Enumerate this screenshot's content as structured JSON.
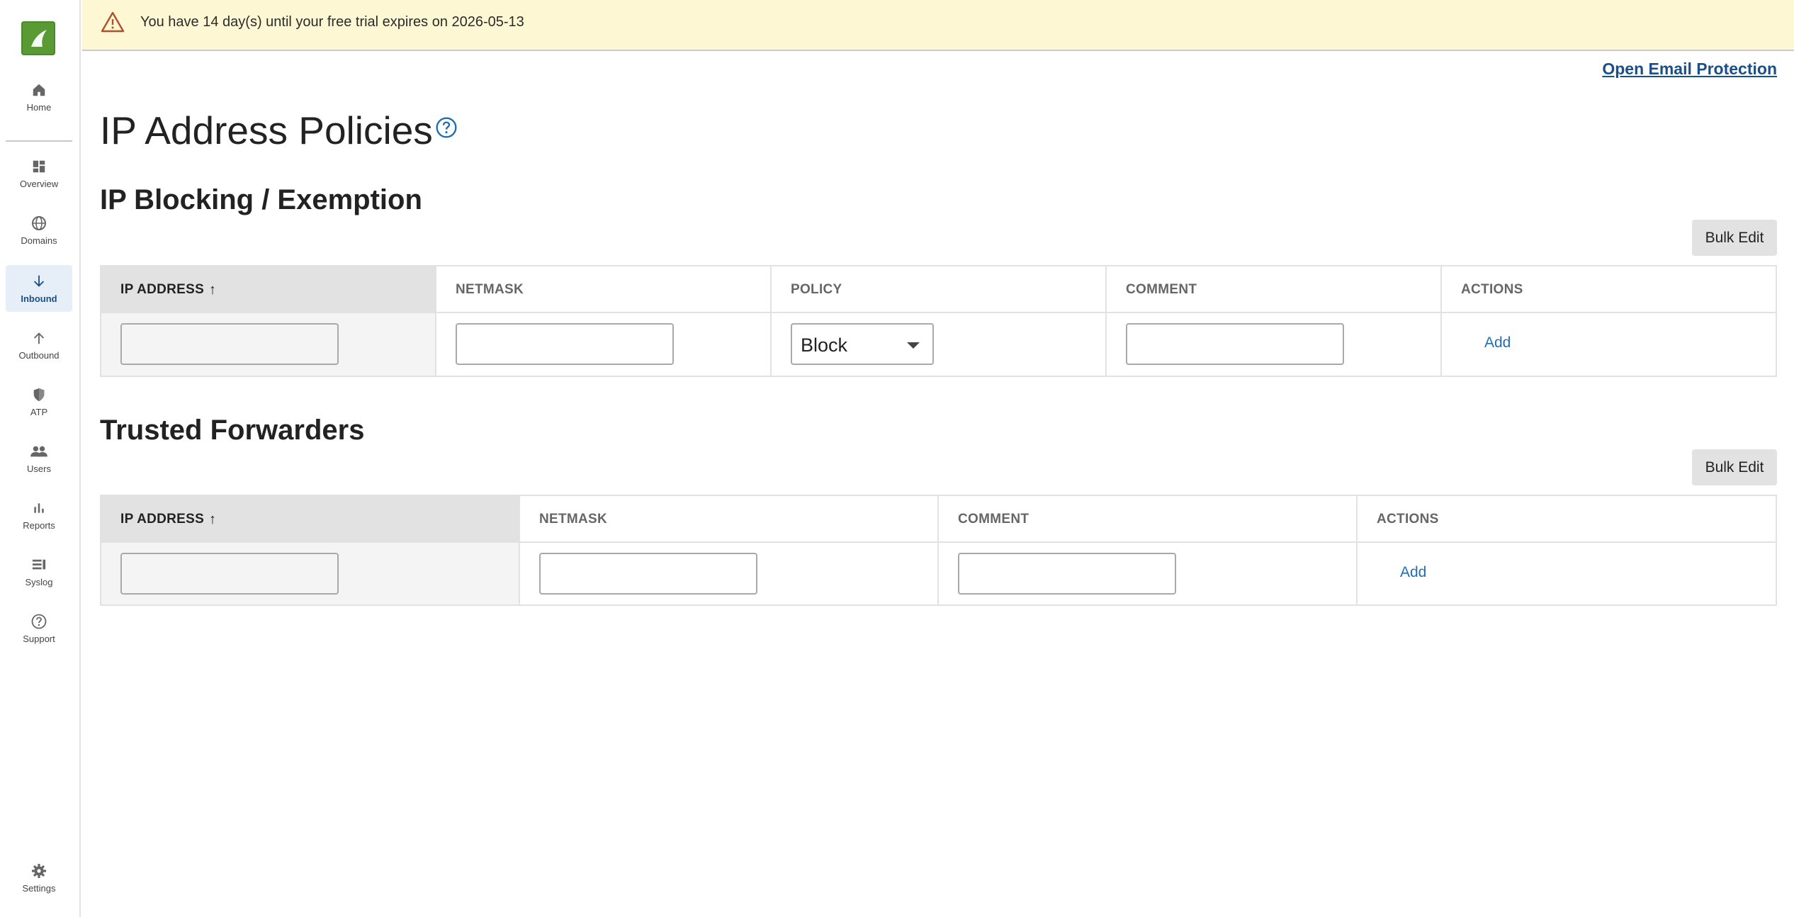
{
  "banner": {
    "icon": "warning-triangle-icon",
    "message": "You have 14 day(s) until your free trial expires on 2026-05-13"
  },
  "sidebar": {
    "logo_icon": "barracuda-logo-icon",
    "items": [
      {
        "label": "Home",
        "icon": "home-icon"
      },
      {
        "label": "Overview",
        "icon": "dashboard-icon"
      },
      {
        "label": "Domains",
        "icon": "globe-icon"
      },
      {
        "label": "Inbound",
        "icon": "arrow-down-icon",
        "active": true
      },
      {
        "label": "Outbound",
        "icon": "arrow-up-icon"
      },
      {
        "label": "ATP",
        "icon": "shield-icon"
      },
      {
        "label": "Users",
        "icon": "users-icon"
      },
      {
        "label": "Reports",
        "icon": "bar-chart-icon"
      },
      {
        "label": "Syslog",
        "icon": "syslog-icon"
      },
      {
        "label": "Support",
        "icon": "help-circle-icon"
      },
      {
        "label": "Settings",
        "icon": "gear-icon"
      }
    ]
  },
  "header": {
    "open_link": "Open Email Protection"
  },
  "page": {
    "title": "IP Address Policies",
    "help_icon": "help-circle-icon"
  },
  "ip_blocking": {
    "title": "IP Blocking / Exemption",
    "bulk_edit": "Bulk Edit",
    "columns": [
      "IP ADDRESS",
      "NETMASK",
      "POLICY",
      "COMMENT",
      "ACTIONS"
    ],
    "sort_arrow": "↑",
    "ip_value": "",
    "netmask_value": "",
    "policy_value": "Block",
    "comment_value": "",
    "add_label": "Add"
  },
  "trusted": {
    "title": "Trusted Forwarders",
    "bulk_edit": "Bulk Edit",
    "columns": [
      "IP ADDRESS",
      "NETMASK",
      "COMMENT",
      "ACTIONS"
    ],
    "sort_arrow": "↑",
    "ip_value": "",
    "netmask_value": "",
    "comment_value": "",
    "add_label": "Add"
  },
  "colors": {
    "accent": "#1f6fb2",
    "link": "#1a4f8b",
    "banner_bg": "#fdf8d3",
    "warning": "#b0502a",
    "logo": "#5a9a35",
    "active_nav_bg": "#e6eff8"
  }
}
